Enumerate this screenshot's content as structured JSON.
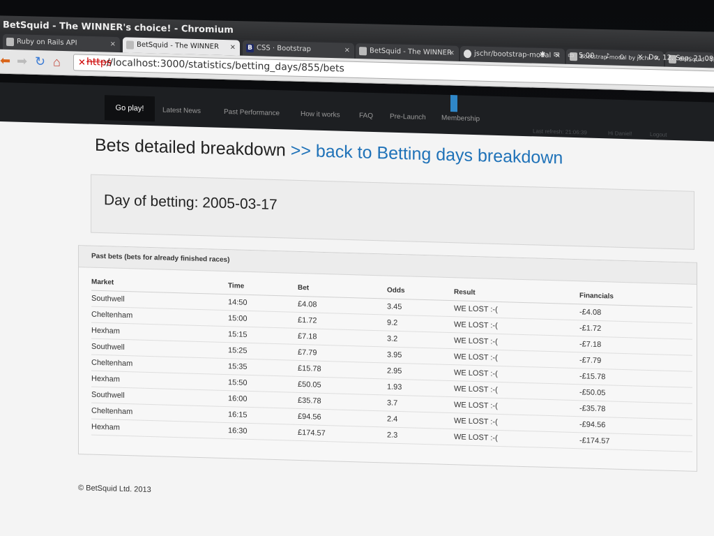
{
  "window": {
    "title": "BetSquid - The WINNER's choice! - Chromium"
  },
  "tabs": [
    {
      "label": "Ruby on Rails API",
      "close": "×"
    },
    {
      "label": "BetSquid - The WINNER",
      "close": "×"
    },
    {
      "label": "CSS · Bootstrap",
      "close": "×"
    },
    {
      "label": "BetSquid - The WINNER",
      "close": "×"
    },
    {
      "label": "jschr/bootstrap-modal",
      "close": "×"
    },
    {
      "label": "Bootstrap-modal by jschr",
      "close": "×"
    },
    {
      "label": "BetSquid - The",
      "close": ""
    }
  ],
  "tray": {
    "battery": "5:00",
    "datetime": "Do, 12. Sep, 21:08"
  },
  "addressbar": {
    "scheme": "https",
    "url": "://localhost:3000/statistics/betting_days/855/bets"
  },
  "navbar": {
    "items": [
      "Go play!",
      "Latest News",
      "Past Performance",
      "How it works",
      "FAQ",
      "Pre-Launch",
      "Membership"
    ],
    "last_refresh": "Last refresh: 21:06:39",
    "greeting": "Hi Daniel!",
    "logout": "Logout"
  },
  "page": {
    "title": "Bets detailed breakdown",
    "back_link": ">> back to Betting days breakdown",
    "day_of_betting": "Day of betting: 2005-03-17",
    "panel_heading": "Past bets (bets for already finished races)"
  },
  "table": {
    "headers": [
      "Market",
      "Time",
      "Bet",
      "Odds",
      "Result",
      "Financials"
    ],
    "rows": [
      [
        "Southwell",
        "14:50",
        "£4.08",
        "3.45",
        "WE LOST :-(",
        "-£4.08"
      ],
      [
        "Cheltenham",
        "15:00",
        "£1.72",
        "9.2",
        "WE LOST :-(",
        "-£1.72"
      ],
      [
        "Hexham",
        "15:15",
        "£7.18",
        "3.2",
        "WE LOST :-(",
        "-£7.18"
      ],
      [
        "Southwell",
        "15:25",
        "£7.79",
        "3.95",
        "WE LOST :-(",
        "-£7.79"
      ],
      [
        "Cheltenham",
        "15:35",
        "£15.78",
        "2.95",
        "WE LOST :-(",
        "-£15.78"
      ],
      [
        "Hexham",
        "15:50",
        "£50.05",
        "1.93",
        "WE LOST :-(",
        "-£50.05"
      ],
      [
        "Southwell",
        "16:00",
        "£35.78",
        "3.7",
        "WE LOST :-(",
        "-£35.78"
      ],
      [
        "Cheltenham",
        "16:15",
        "£94.56",
        "2.4",
        "WE LOST :-(",
        "-£94.56"
      ],
      [
        "Hexham",
        "16:30",
        "£174.57",
        "2.3",
        "WE LOST :-(",
        "-£174.57"
      ]
    ]
  },
  "footer": {
    "copyright": "© BetSquid Ltd. 2013"
  }
}
